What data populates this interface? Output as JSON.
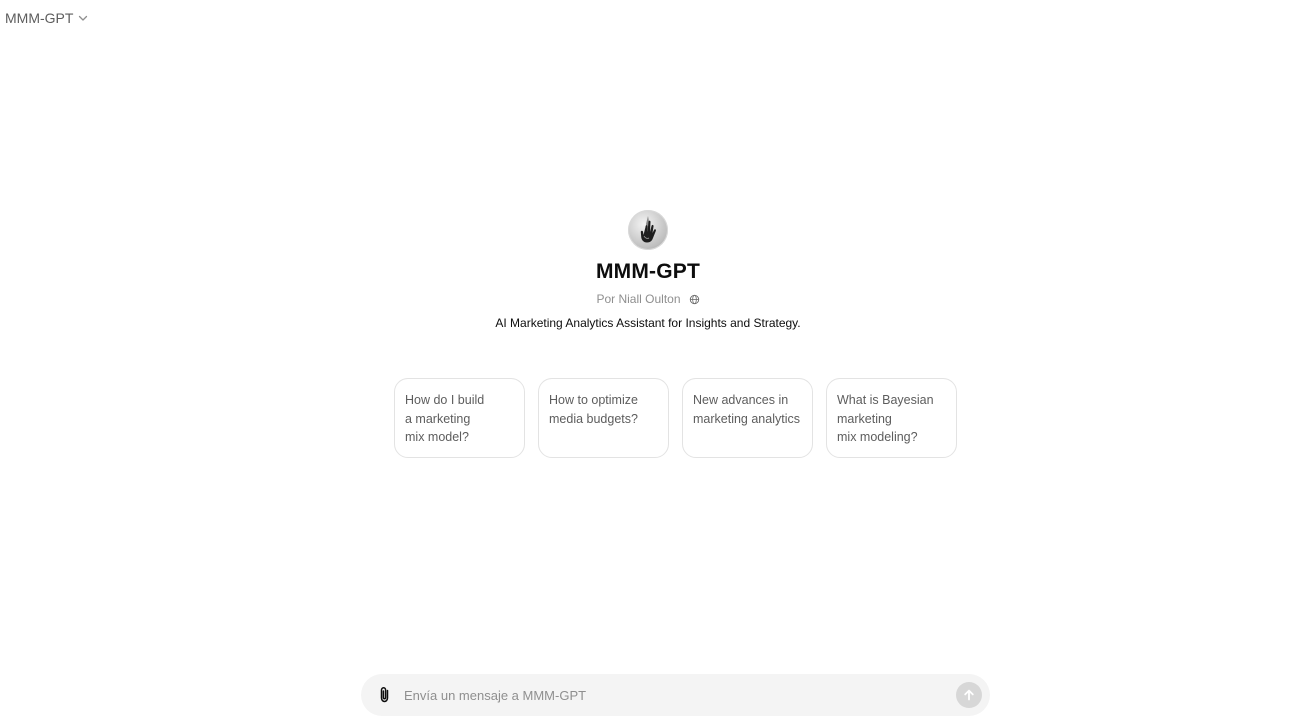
{
  "header": {
    "model_name": "MMM-GPT",
    "chevron_icon": "chevron-down-icon"
  },
  "gpt": {
    "avatar_icon": "hand-logo-icon",
    "title": "MMM-GPT",
    "byline": "Por Niall Oulton",
    "byline_icon": "globe-icon",
    "description": "AI Marketing Analytics Assistant for Insights and Strategy."
  },
  "starters": [
    {
      "label": "How do I build\na marketing\nmix model?"
    },
    {
      "label": "How to optimize\nmedia budgets?"
    },
    {
      "label": "New advances in\nmarketing analytics"
    },
    {
      "label": "What is Bayesian\nmarketing\nmix modeling?"
    }
  ],
  "composer": {
    "placeholder": "Envía un mensaje a MMM-GPT",
    "value": "",
    "attach_icon": "paperclip-icon",
    "send_icon": "arrow-up-icon"
  },
  "colors": {
    "background": "#ffffff",
    "text": "#0d0d0d",
    "muted": "#8f8f8f",
    "composer_bg": "#f4f4f4",
    "send_disabled": "#d7d7d7"
  }
}
